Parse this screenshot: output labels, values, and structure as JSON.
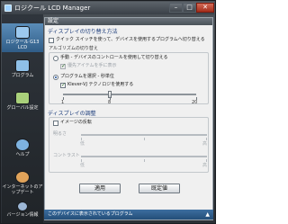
{
  "window": {
    "title": "ロジクール LCD Manager",
    "min": "–",
    "max": "□",
    "close": "✕"
  },
  "sidebar": {
    "items": [
      {
        "label": "ロジクール G13 LCD",
        "icon": "g13-device-icon",
        "color": "#9cc9ef",
        "active": true
      },
      {
        "label": "プログラム",
        "icon": "program-icon",
        "color": "#8fc0e8"
      },
      {
        "label": "グローバル設定",
        "icon": "global-settings-icon",
        "color": "#a9d07a"
      },
      {
        "label": "ヘルプ",
        "icon": "help-icon",
        "color": "#7eb2e0"
      },
      {
        "label": "インターネットのアップデート",
        "icon": "internet-update-icon",
        "color": "#e0a35a"
      },
      {
        "label": "バージョン情報",
        "icon": "info-icon",
        "color": "#9cb7d6"
      }
    ]
  },
  "panel": {
    "header": "設定",
    "switching": {
      "title": "ディスプレイの切り替え方法",
      "quick_switch": "クイック スイッチを使って、デバイスを使用するプログラムへ切り替える",
      "app_switch_title": "アルゴリズムの切り替え",
      "manual_radio": "手動 - デバイスのコントロールを使用して切り替える",
      "priority_check": "優先アイテムを手に表示",
      "program_radio": "プログラムを選択 - 秒単位",
      "klever_check": "Klever-VJ テクノロジを使用する",
      "slider": {
        "min": "1",
        "mid": "8",
        "max": "20",
        "value": 8
      }
    },
    "display": {
      "title": "ディスプレイの調整",
      "invert_check": "イメージの反転",
      "brightness_label": "明るさ",
      "brightness_low": "低",
      "brightness_high": "高",
      "contrast_label": "コントラスト"
    },
    "buttons": {
      "apply": "適用",
      "defaults": "既定値"
    }
  },
  "footer": {
    "link": "このデバイスに表示されているプログラム",
    "arrow": "▲"
  }
}
